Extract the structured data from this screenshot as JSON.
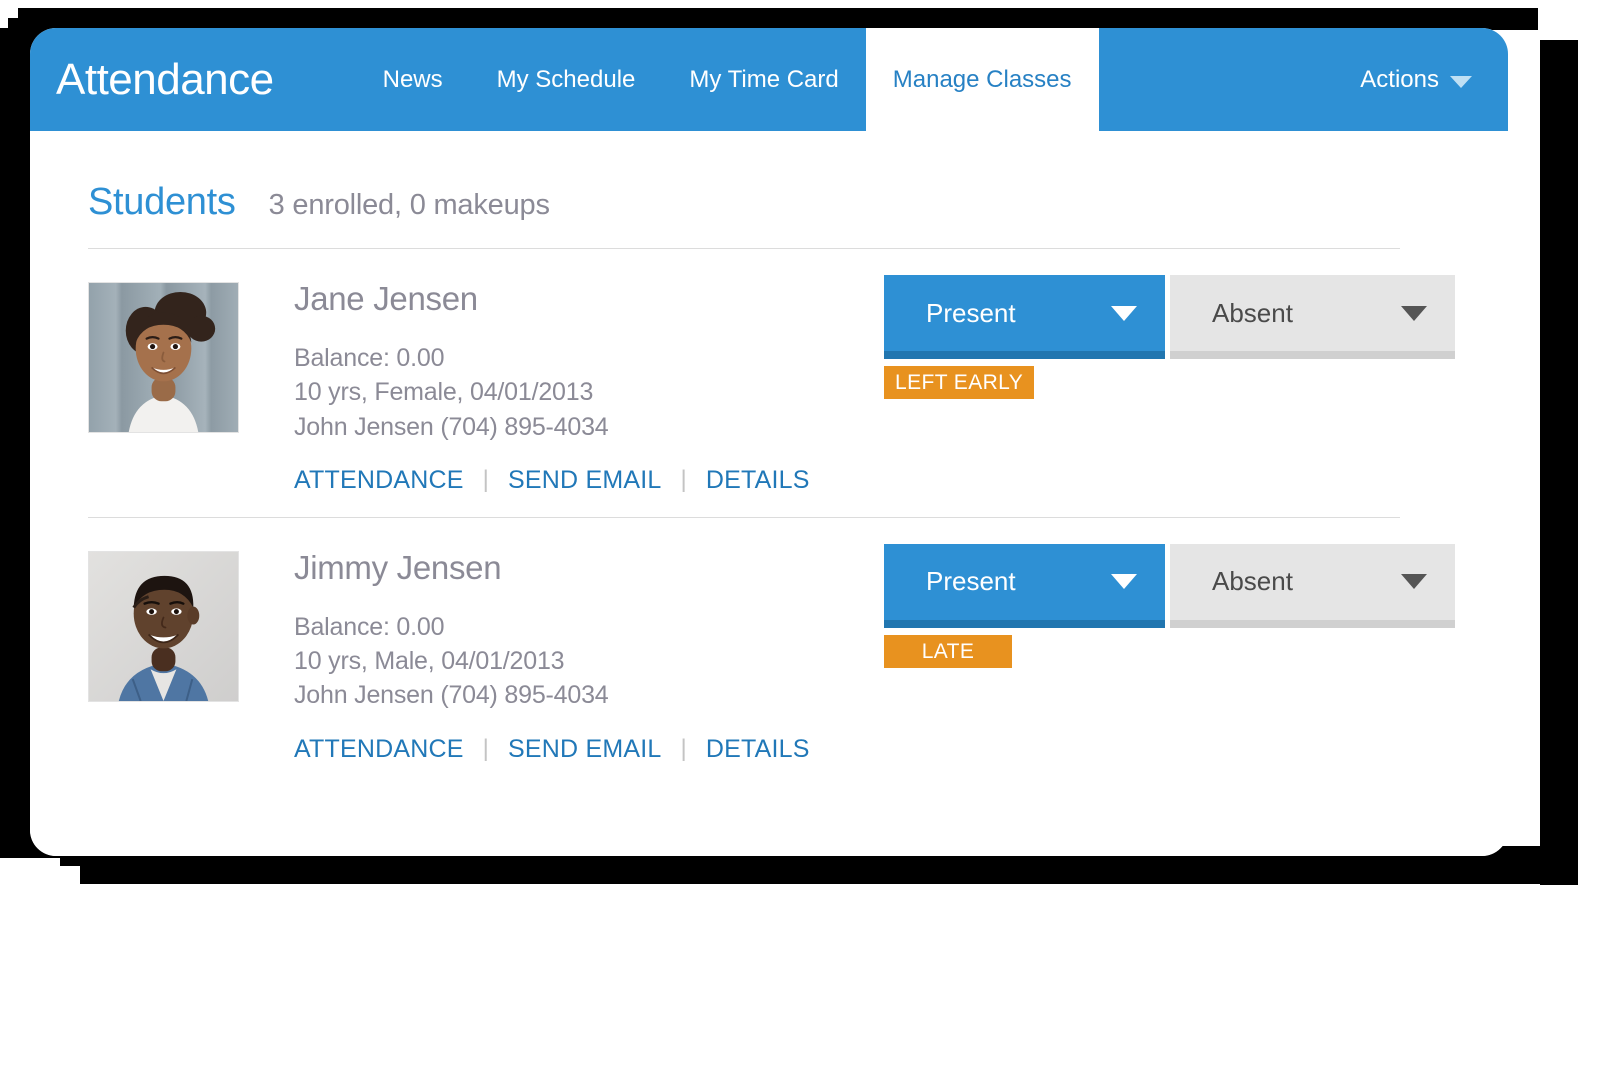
{
  "theme": {
    "brand_blue": "#2e90d4",
    "brand_blue_dark": "#2176b0",
    "link_blue": "#2178b8",
    "muted_text": "#8b8a96",
    "badge_orange": "#e8921f",
    "absent_gray": "#e5e5e5",
    "page_background": "#ffffff",
    "shadow": "#000000"
  },
  "header": {
    "brand": "Attendance",
    "tabs": [
      {
        "label": "News",
        "active": false
      },
      {
        "label": "My Schedule",
        "active": false
      },
      {
        "label": "My Time Card",
        "active": false
      },
      {
        "label": "Manage Classes",
        "active": true
      }
    ],
    "actions": {
      "label": "Actions",
      "icon": "chevron-down-icon"
    }
  },
  "main": {
    "title": "Students",
    "summary": "3 enrolled, 0 makeups",
    "link_labels": {
      "attendance": "ATTENDANCE",
      "send_email": "SEND EMAIL",
      "details": "DETAILS",
      "separator": "|"
    },
    "attendance_options": {
      "present": "Present",
      "absent": "Absent"
    },
    "students": [
      {
        "name": "Jane Jensen",
        "balance": "Balance: 0.00",
        "demographics": "10 yrs, Female, 04/01/2013",
        "guardian": "John Jensen (704) 895-4034",
        "photo_alt": "photo-jane-jensen",
        "present_label": "Present",
        "absent_label": "Absent",
        "selected": "Present",
        "status_badge": "LEFT EARLY",
        "badge_centered": false
      },
      {
        "name": "Jimmy Jensen",
        "balance": "Balance: 0.00",
        "demographics": "10 yrs, Male, 04/01/2013",
        "guardian": "John Jensen (704) 895-4034",
        "photo_alt": "photo-jimmy-jensen",
        "present_label": "Present",
        "absent_label": "Absent",
        "selected": "Present",
        "status_badge": "LATE",
        "badge_centered": true
      }
    ]
  }
}
